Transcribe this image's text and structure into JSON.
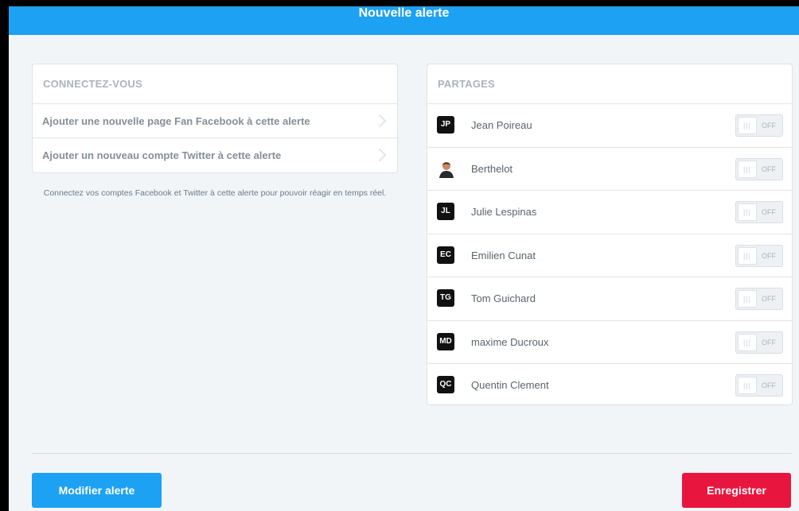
{
  "header": {
    "title": "Nouvelle alerte"
  },
  "connect": {
    "title": "CONNECTEZ-VOUS",
    "items": [
      {
        "label": "Ajouter une nouvelle page Fan Facebook à cette alerte"
      },
      {
        "label": "Ajouter un nouveau compte Twitter à cette alerte"
      }
    ],
    "help": "Connectez vos comptes Facebook et Twitter à cette alerte pour pouvoir réagir en temps réel."
  },
  "share": {
    "title": "PARTAGES",
    "users": [
      {
        "initials": "JP",
        "name": "Jean Poireau",
        "toggle": "OFF"
      },
      {
        "initials": "",
        "name": "Berthelot",
        "toggle": "OFF"
      },
      {
        "initials": "JL",
        "name": "Julie Lespinas",
        "toggle": "OFF"
      },
      {
        "initials": "EC",
        "name": "Emilien Cunat",
        "toggle": "OFF"
      },
      {
        "initials": "TG",
        "name": "Tom Guichard",
        "toggle": "OFF"
      },
      {
        "initials": "MD",
        "name": "maxime Ducroux",
        "toggle": "OFF"
      },
      {
        "initials": "QC",
        "name": "Quentin Clement",
        "toggle": "OFF"
      }
    ]
  },
  "actions": {
    "modify_label": "Modifier alerte",
    "save_label": "Enregistrer"
  },
  "colors": {
    "header": "#1da1f2",
    "primary": "#1da1f2",
    "danger": "#e8163f",
    "background": "#f1f5f8"
  }
}
